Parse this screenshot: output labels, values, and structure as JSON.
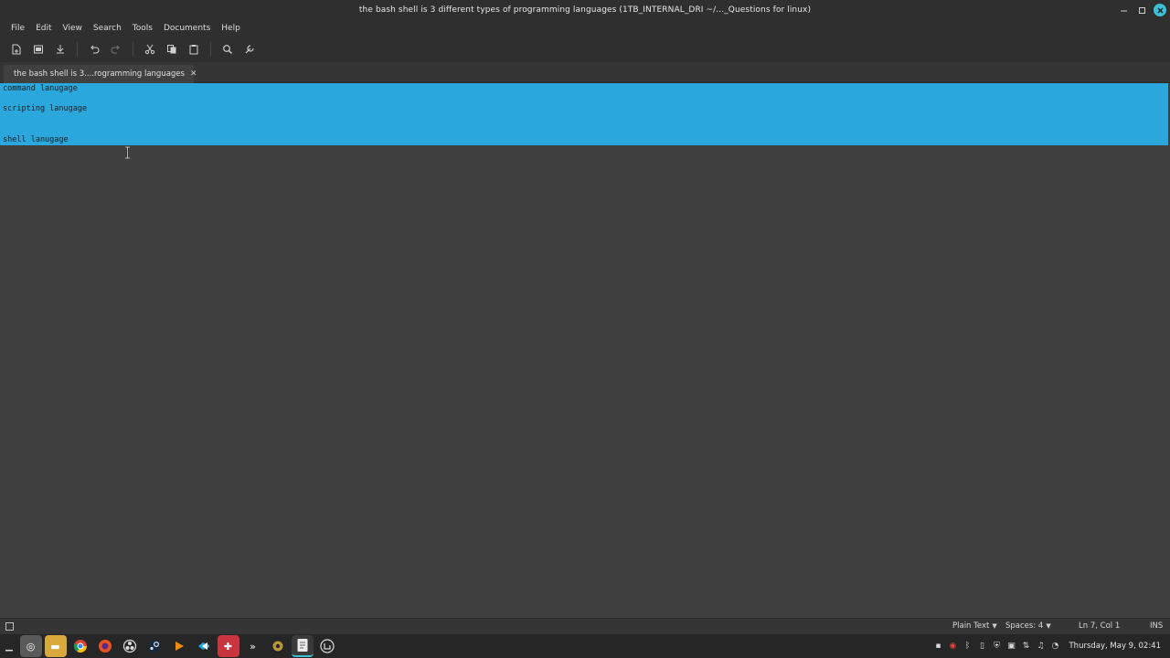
{
  "window": {
    "title": "the bash shell is 3 different types of programming languages (1TB_INTERNAL_DRI ~/..._Questions for linux)"
  },
  "menu": [
    "File",
    "Edit",
    "View",
    "Search",
    "Tools",
    "Documents",
    "Help"
  ],
  "toolbar": {
    "icons": [
      "new-document-icon",
      "open-icon",
      "save-icon",
      "undo-icon",
      "redo-icon",
      "cut-icon",
      "copy-icon",
      "paste-icon",
      "search-icon",
      "tools-icon"
    ]
  },
  "tabs": [
    {
      "label": "the bash shell is 3....rogramming languages",
      "close": "✕"
    }
  ],
  "editor": {
    "lines": [
      "command lanugage",
      "",
      "scripting lanugage",
      "",
      "",
      "shell lanugage"
    ],
    "selection_color": "#2aa7dc"
  },
  "statusbar": {
    "syntax": "Plain Text",
    "indent": "Spaces: 4",
    "position": "Ln 7, Col 1",
    "mode": "INS"
  },
  "taskbar": {
    "apps": [
      "files-icon",
      "folder-icon",
      "chrome-icon",
      "firefox-icon",
      "obs-icon",
      "steam-icon",
      "vlc-icon",
      "vscode-icon",
      "game-icon",
      "terminal-icon",
      "settings-icon",
      "text-editor-icon",
      "mint-icon"
    ],
    "clock": "Thursday, May 9, 02:41"
  },
  "colors": {
    "accent": "#3dbfd6",
    "background": "#404040",
    "chrome": "#2f2f2f"
  }
}
